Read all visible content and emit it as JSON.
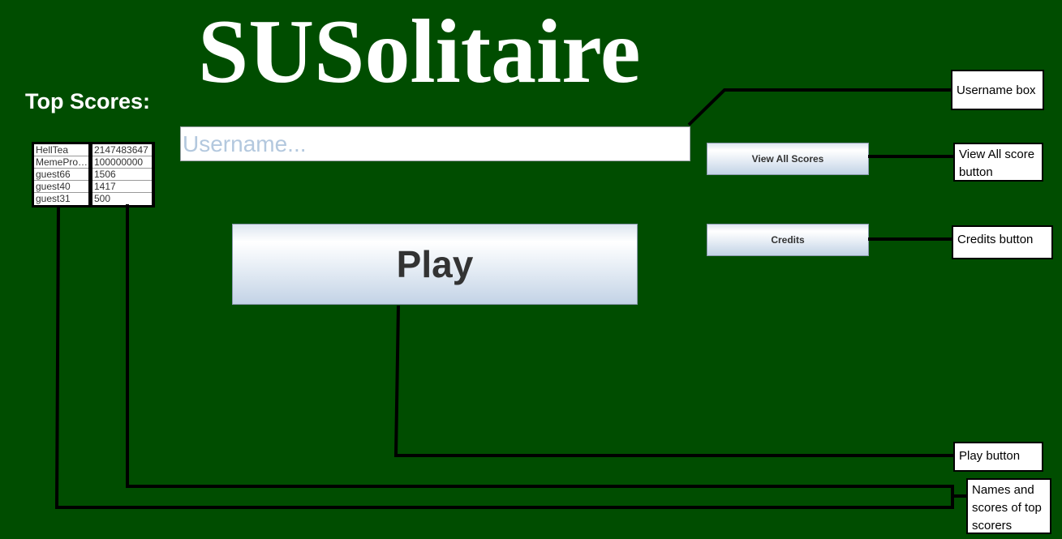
{
  "app": {
    "title": "SUSolitaire",
    "top_scores_label": "Top Scores:"
  },
  "top_scores": {
    "names": [
      "HellTea",
      "MemeProte...",
      "guest66",
      "guest40",
      "guest31"
    ],
    "scores": [
      "2147483647",
      "100000000",
      "1506",
      "1417",
      "500"
    ]
  },
  "username": {
    "value": "",
    "placeholder": "Username..."
  },
  "buttons": {
    "play": "Play",
    "view_all_scores": "View All Scores",
    "credits": "Credits"
  },
  "annotations": {
    "username_box": "Username box",
    "view_all_score_button": "View All score button",
    "credits_button": "Credits button",
    "play_button": "Play button",
    "names_and_scores": "Names and scores of top scorers"
  },
  "colors": {
    "background": "#004d00",
    "text": "#ffffff"
  }
}
